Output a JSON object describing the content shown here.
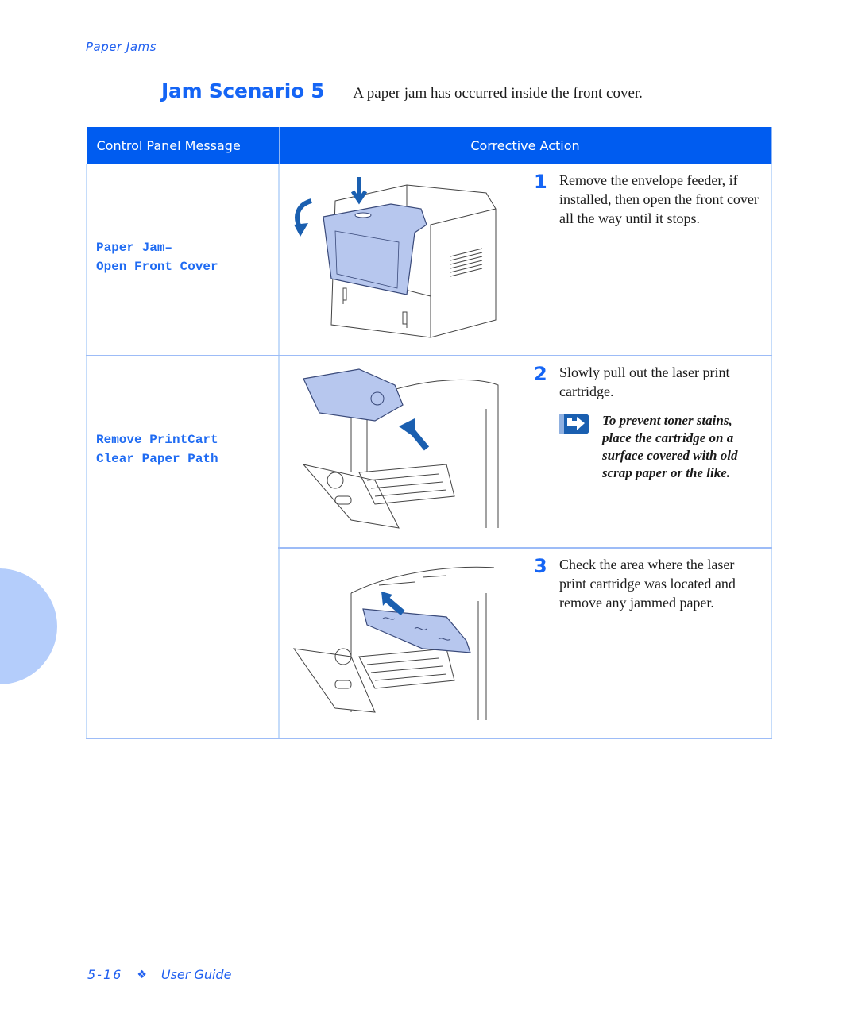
{
  "running_head": "Paper Jams",
  "title": "Jam Scenario 5",
  "description": "A paper jam has occurred inside the front cover.",
  "table": {
    "headers": {
      "message": "Control Panel Message",
      "action": "Corrective Action"
    },
    "rows": [
      {
        "message_lines": [
          "Paper Jam–",
          "Open Front Cover"
        ],
        "steps": [
          {
            "number": "1",
            "text": "Remove the envelope feeder, if installed, then open the front cover all the way until it stops.",
            "illustration": "printer-front-cover-opening"
          }
        ]
      },
      {
        "message_lines": [
          "Remove PrintCart",
          "Clear Paper Path"
        ],
        "steps": [
          {
            "number": "2",
            "text": "Slowly pull out the laser print cartridge.",
            "illustration": "print-cartridge-removal",
            "note": {
              "icon": "note-arrow-icon",
              "text": "To prevent toner stains, place the cartridge on a surface covered with old scrap paper or the like."
            }
          },
          {
            "number": "3",
            "text": "Check the area where the laser print cartridge was located and remove any jammed paper.",
            "illustration": "jammed-paper-removal"
          }
        ]
      }
    ]
  },
  "footer": {
    "page": "5-16",
    "separator": "❖",
    "guide": "User Guide"
  },
  "colors": {
    "accent": "#1565f5",
    "header_bg": "#005cf0",
    "tab": "#b4cdfb",
    "illustration_fill": "#b7c7ee",
    "arrow": "#1a5fb0"
  }
}
